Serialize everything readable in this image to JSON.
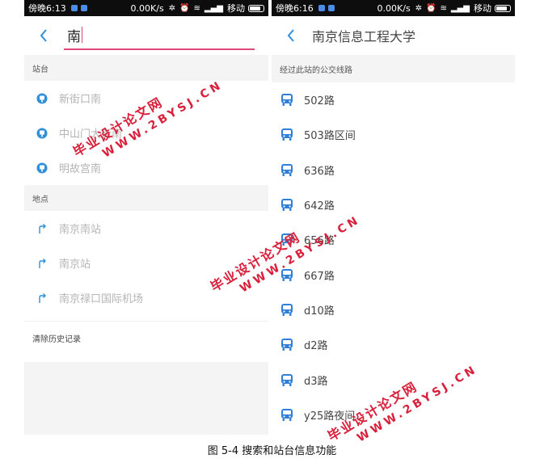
{
  "left_screen": {
    "status_bar": {
      "time": "傍晚6:13",
      "speed": "0.00K/s",
      "carrier": "移动"
    },
    "search": {
      "value": "南"
    },
    "stations_section": {
      "header": "站台",
      "items": [
        {
          "label": "新街口南",
          "icon": "bus-stop-icon"
        },
        {
          "label": "中山门大街南",
          "icon": "bus-stop-icon"
        },
        {
          "label": "明故宫南",
          "icon": "bus-stop-icon"
        }
      ]
    },
    "places_section": {
      "header": "地点",
      "items": [
        {
          "label": "南京南站",
          "icon": "turn-arrow-icon"
        },
        {
          "label": "南京站",
          "icon": "turn-arrow-icon"
        },
        {
          "label": "南京禄口国际机场",
          "icon": "turn-arrow-icon"
        }
      ]
    },
    "clear_history": "清除历史记录"
  },
  "right_screen": {
    "status_bar": {
      "time": "傍晚6:16",
      "speed": "0.00K/s",
      "carrier": "移动"
    },
    "title": "南京信息工程大学",
    "routes_header": "经过此站的公交线路",
    "routes": [
      "502路",
      "503路区间",
      "636路",
      "642路",
      "656路",
      "667路",
      "d10路",
      "d2路",
      "d3路",
      "y25路夜间"
    ]
  },
  "caption": "图 5-4 搜索和站台信息功能",
  "watermark": {
    "text": "毕业设计论文网",
    "url": "WWW.2BYSJ.CN"
  },
  "colors": {
    "accent": "#e0457b",
    "stop_icon": "#2f8fd8",
    "bus_icon": "#2f7fd8",
    "watermark": "#d9203b"
  }
}
